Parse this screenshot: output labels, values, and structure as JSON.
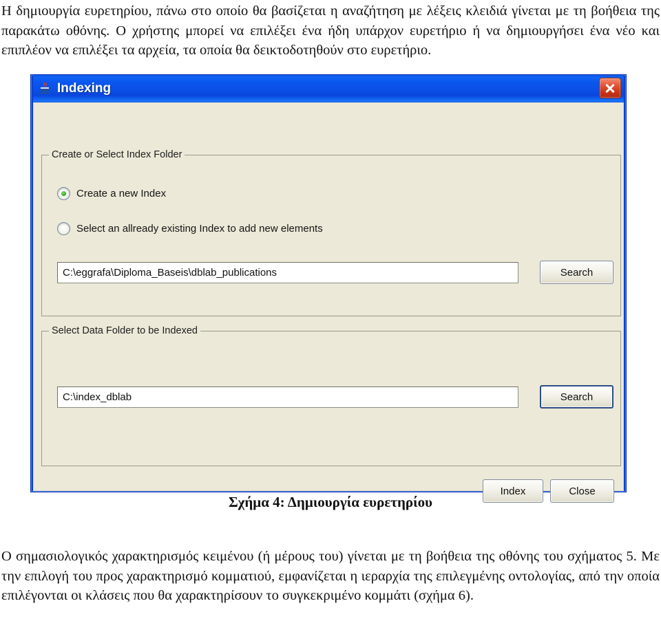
{
  "document": {
    "intro_paragraph": "Η δημιουργία ευρετηρίου, πάνω στο οποίο θα βασίζεται η αναζήτηση με λέξεις κλειδιά γίνεται με τη βοήθεια της παρακάτω οθόνης. Ο χρήστης μπορεί να επιλέξει ένα ήδη υπάρχον ευρετήριο ή να δημιουργήσει ένα νέο και επιπλέον να επιλέξει τα αρχεία, τα οποία θα δεικτοδοτηθούν στο ευρετήριο.",
    "figure_caption": "Σχήμα 4: Δημιουργία ευρετηρίου",
    "outro_paragraph": "Ο σημασιολογικός χαρακτηρισμός κειμένου (ή μέρους του) γίνεται με τη βοήθεια της οθόνης του σχήματος 5. Με την επιλογή του προς χαρακτηρισμό κομματιού, εμφανίζεται η ιεραρχία της επιλεγμένης οντολογίας, από την οποία επιλέγονται οι κλάσεις που θα χαρακτηρίσουν το συγκεκριμένο κομμάτι (σχήμα 6)."
  },
  "dialog": {
    "title": "Indexing",
    "title_icon": "java-coffee-cup-icon",
    "close_icon": "close-icon",
    "colors": {
      "titlebar_blue": "#0a4fe0",
      "client_background": "#ece9d8",
      "close_red": "#cf3417",
      "radio_green": "#37a828"
    },
    "group_index_folder": {
      "title": "Create or Select Index Folder",
      "radios": [
        {
          "label": "Create a new Index",
          "checked": true
        },
        {
          "label": "Select an allready existing Index to add new elements",
          "checked": false
        }
      ],
      "path_value": "C:\\eggrafa\\Diploma_Baseis\\dblab_publications",
      "search_button": "Search"
    },
    "group_data_folder": {
      "title": "Select Data Folder to be Indexed",
      "path_value": "C:\\index_dblab",
      "search_button": "Search"
    },
    "actions": {
      "index_button": "Index",
      "close_button": "Close"
    }
  }
}
